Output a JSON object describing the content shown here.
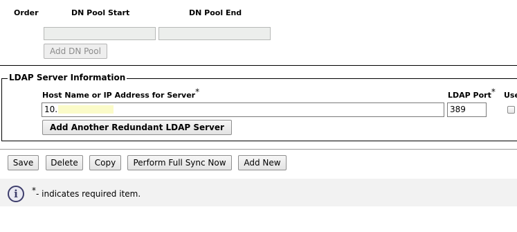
{
  "dn_pool": {
    "col_order": "Order",
    "col_start": "DN Pool Start",
    "col_end": "DN Pool End",
    "add_button": "Add DN Pool"
  },
  "ldap_server": {
    "legend": "LDAP Server Information",
    "host_label": "Host Name or IP Address for Server",
    "host_value": "10.",
    "port_label": "LDAP Port",
    "port_value": "389",
    "use_label": "Use",
    "required_star": "*",
    "add_server_button": "Add Another Redundant LDAP Server"
  },
  "toolbar": {
    "save": "Save",
    "delete": "Delete",
    "copy": "Copy",
    "full_sync": "Perform Full Sync Now",
    "add_new": "Add New"
  },
  "footer": {
    "info_glyph": "i",
    "required_star": "*",
    "required_note": "- indicates required item."
  }
}
